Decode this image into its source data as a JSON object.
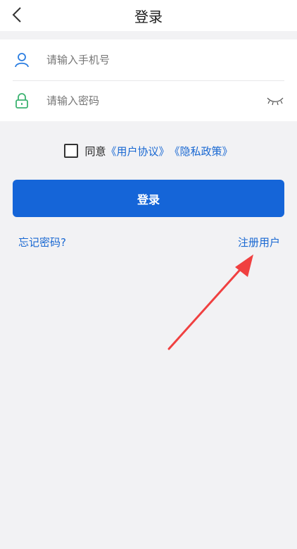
{
  "header": {
    "title": "登录",
    "back_icon": "chevron-left-icon"
  },
  "form": {
    "phone": {
      "placeholder": "请输入手机号",
      "icon": "user-icon"
    },
    "password": {
      "placeholder": "请输入密码",
      "icon": "lock-icon",
      "toggle_icon": "eye-closed-icon"
    }
  },
  "agreement": {
    "prefix": "同意",
    "user_agreement": "《用户协议》",
    "privacy_policy": "《隐私政策》",
    "checked": false
  },
  "login_button": "登录",
  "forgot_password": "忘记密码?",
  "register": "注册用户",
  "colors": {
    "primary": "#1565d8",
    "link": "#1968d2",
    "background": "#f2f2f4",
    "annotation_arrow": "#f04040"
  }
}
